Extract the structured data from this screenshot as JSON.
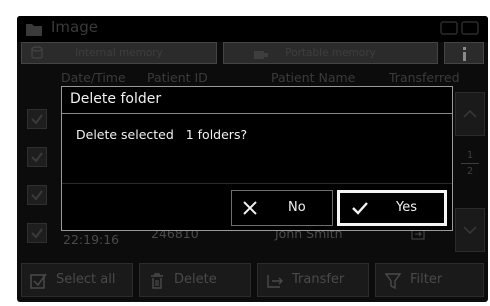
{
  "window": {
    "title": "Image"
  },
  "tabs": [
    {
      "label": "Internal memory",
      "icon": "database-icon"
    },
    {
      "label": "Portable memory",
      "icon": "usb-drive-icon"
    },
    {
      "label": "",
      "icon": "info-icon"
    }
  ],
  "table": {
    "columns": [
      "Date/Time",
      "Patient ID",
      "Patient Name",
      "Transferred"
    ],
    "rows": [
      {
        "time": "",
        "patient_id": "",
        "patient_name": ""
      },
      {
        "time": "",
        "patient_id": "",
        "patient_name": ""
      },
      {
        "time": "",
        "patient_id": "",
        "patient_name": ""
      },
      {
        "time": "22:19:16",
        "patient_id": "246810",
        "patient_name": "John Smith"
      }
    ]
  },
  "pager": {
    "current": "1",
    "total": "2"
  },
  "toolbar": {
    "select_all": "Select all",
    "delete": "Delete",
    "transfer": "Transfer",
    "filter": "Filter"
  },
  "dialog": {
    "title": "Delete folder",
    "message": "Delete selected   1 folders?",
    "no_label": "No",
    "yes_label": "Yes"
  },
  "colors": {
    "dialog_bg": "#000000",
    "text": "#f2f2f2",
    "dimmed_text": "#3e3e3e"
  }
}
